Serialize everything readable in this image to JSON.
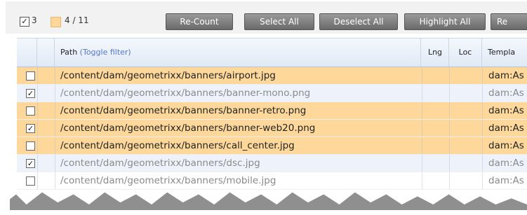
{
  "toolbar": {
    "checkbox_checked": true,
    "selected_count": "3",
    "highlight_ratio": "4 / 11",
    "buttons": [
      "Re-Count",
      "Select All",
      "Deselect All",
      "Highlight All",
      "Re"
    ]
  },
  "grid": {
    "columns": {
      "path": "Path",
      "toggle_filter": "(Toggle filter)",
      "lng": "Lng",
      "loc": "Loc",
      "template": "Templa"
    },
    "rows": [
      {
        "checked": false,
        "highlighted": true,
        "path": "/content/dam/geometrixx/banners/airport.jpg",
        "template": "dam:As"
      },
      {
        "checked": true,
        "highlighted": false,
        "path": "/content/dam/geometrixx/banners/banner-mono.png",
        "template": "dam:As"
      },
      {
        "checked": false,
        "highlighted": true,
        "path": "/content/dam/geometrixx/banners/banner-retro.png",
        "template": "dam:As"
      },
      {
        "checked": true,
        "highlighted": true,
        "path": "/content/dam/geometrixx/banners/banner-web20.png",
        "template": "dam:As"
      },
      {
        "checked": false,
        "highlighted": true,
        "path": "/content/dam/geometrixx/banners/call_center.jpg",
        "template": "dam:As"
      },
      {
        "checked": true,
        "highlighted": false,
        "path": "/content/dam/geometrixx/banners/dsc.jpg",
        "template": "dam:As"
      },
      {
        "checked": false,
        "highlighted": false,
        "path": "/content/dam/geometrixx/banners/mobile.jpg",
        "template": "dam:As"
      }
    ]
  },
  "colors": {
    "highlight_row": "#fdd89a",
    "plain_row": "#eef3fb",
    "white_row": "#ffffff",
    "highlight_text": "#222222",
    "dim_text": "#8a8a8a",
    "toggle_link": "#5577c7"
  }
}
